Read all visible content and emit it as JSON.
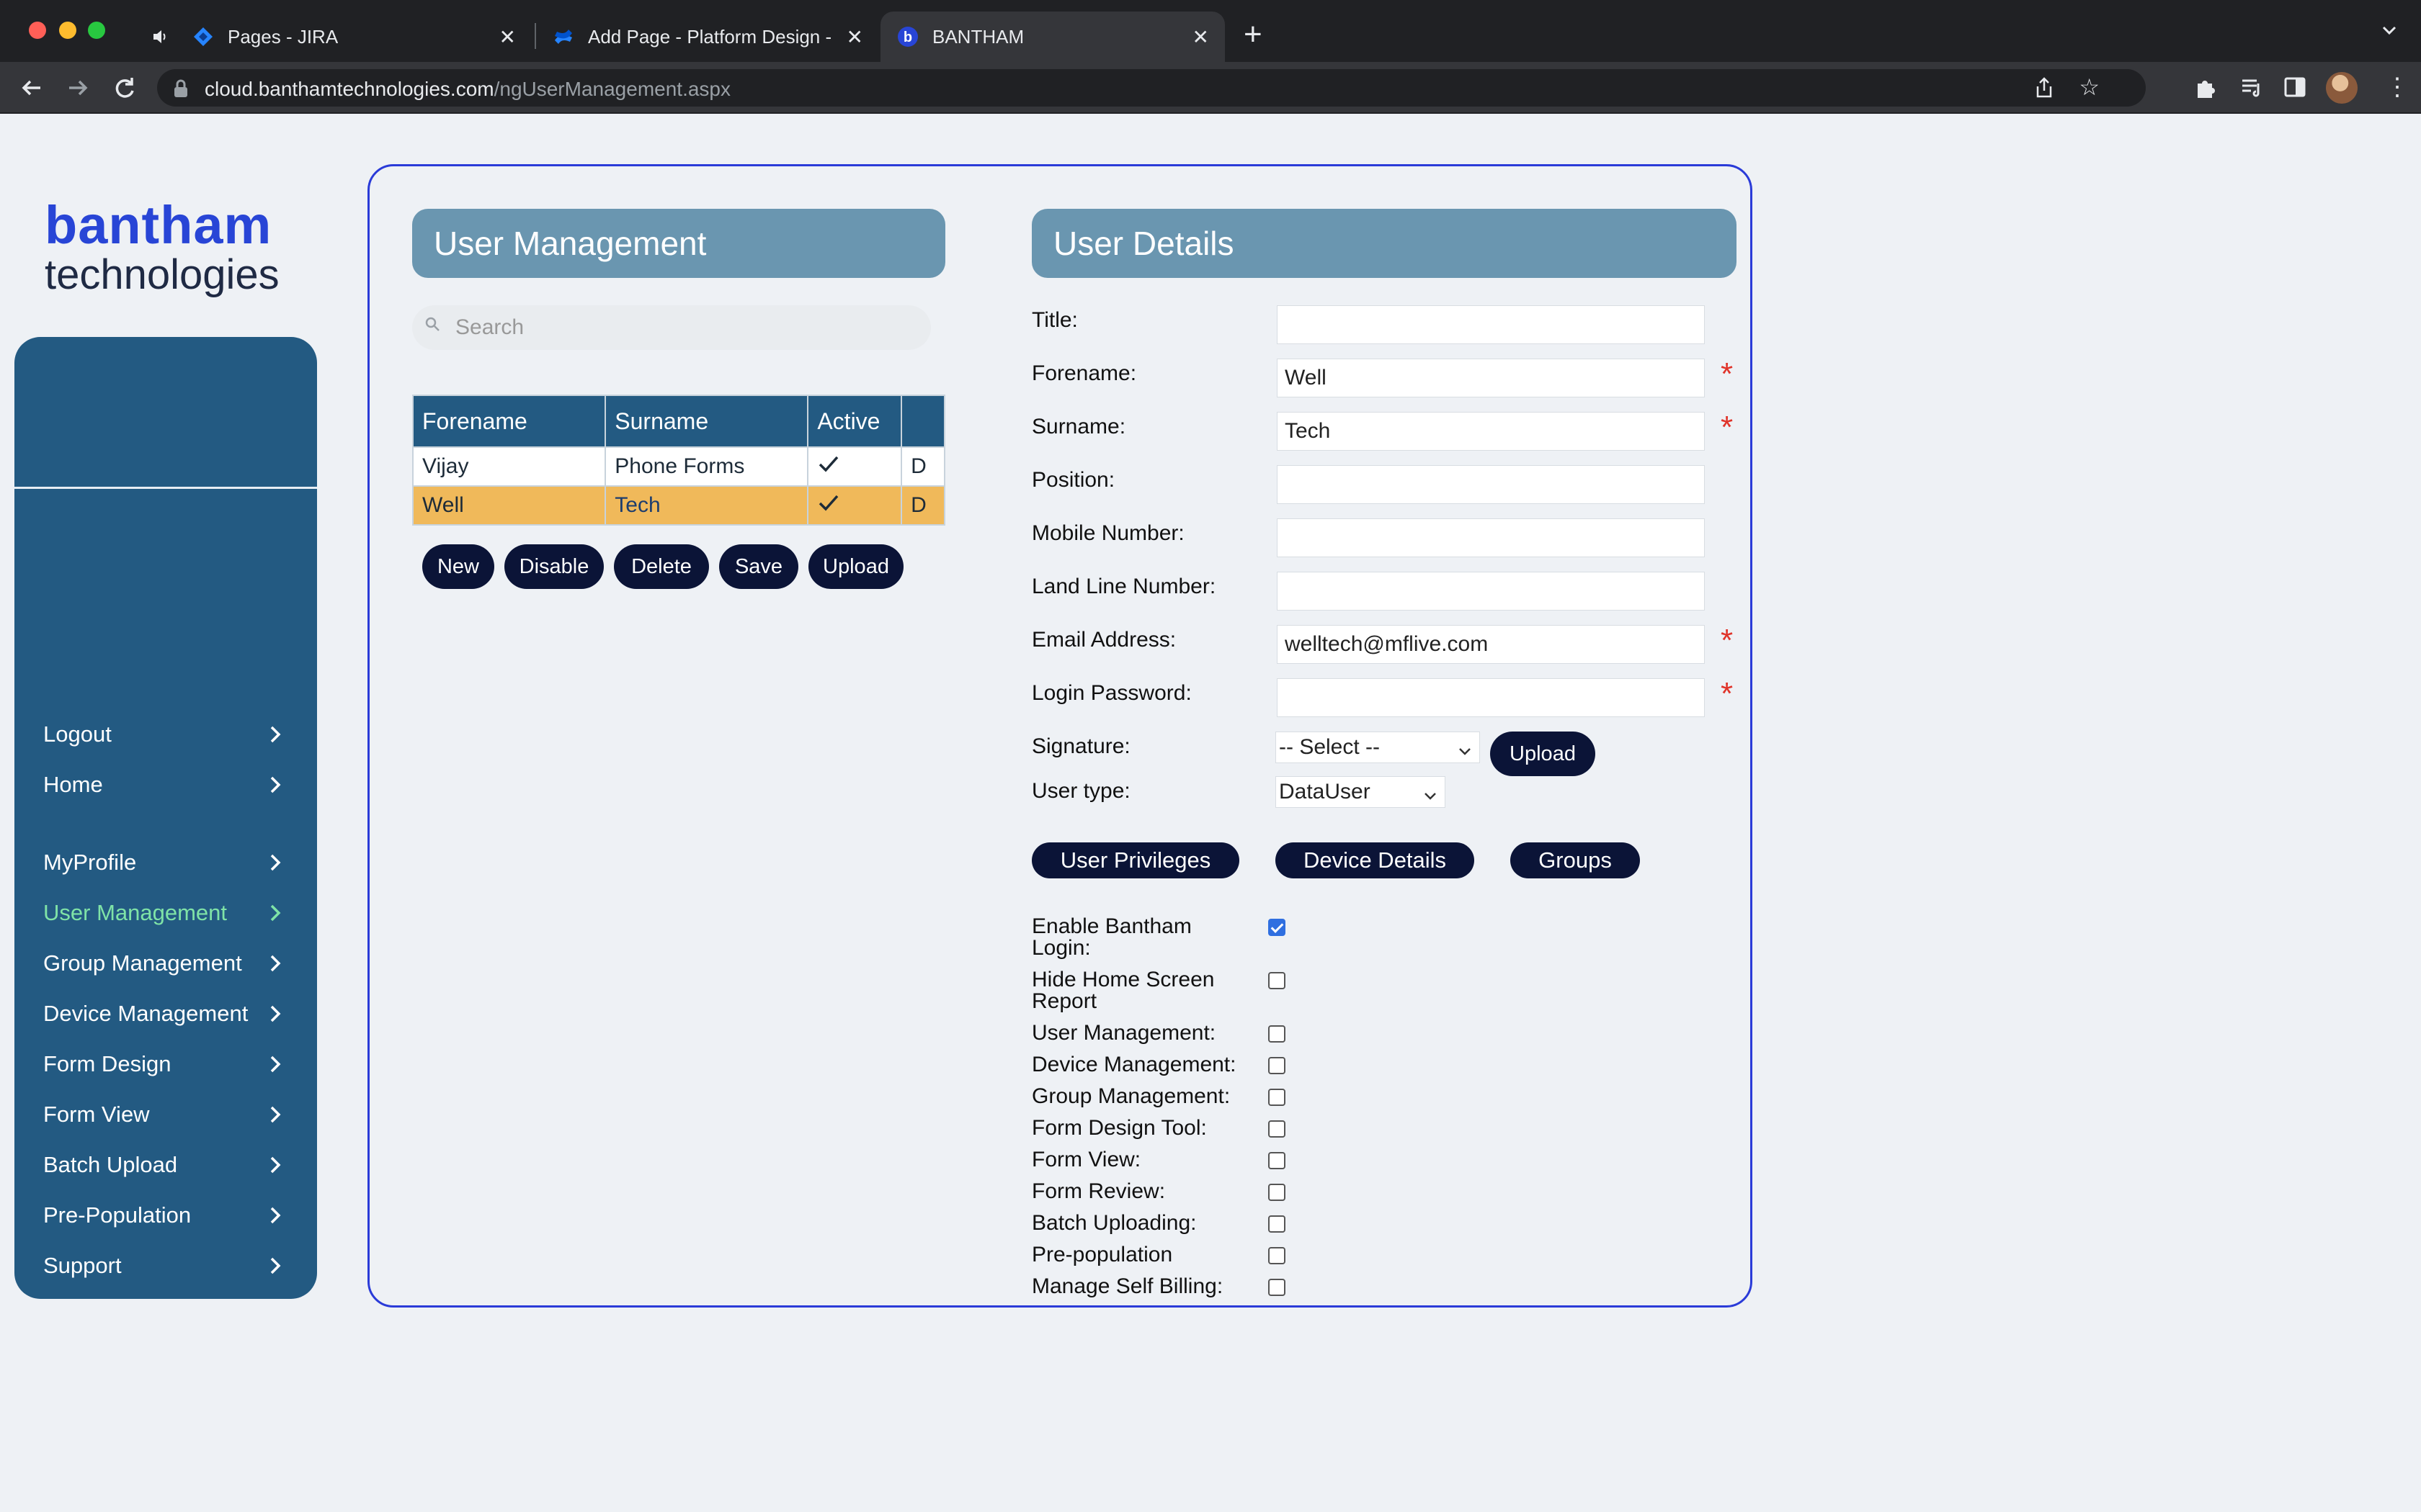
{
  "browser": {
    "tabs": [
      {
        "title": "Pages - JIRA",
        "icon": "jira-icon"
      },
      {
        "title": "Add Page - Platform Design - J",
        "icon": "confluence-icon"
      },
      {
        "title": "BANTHAM",
        "icon": "bantham-icon"
      }
    ],
    "url_domain": "cloud.banthamtechnologies.com",
    "url_path": "/ngUserManagement.aspx"
  },
  "logo": {
    "line1": "bantham",
    "line2": "technologies"
  },
  "sidebar": {
    "items": [
      {
        "label": "Logout",
        "active": false
      },
      {
        "label": "Home",
        "active": false
      },
      {
        "label": "MyProfile",
        "active": false
      },
      {
        "label": "User Management",
        "active": true
      },
      {
        "label": "Group Management",
        "active": false
      },
      {
        "label": "Device Management",
        "active": false
      },
      {
        "label": "Form Design",
        "active": false
      },
      {
        "label": "Form View",
        "active": false
      },
      {
        "label": "Batch Upload",
        "active": false
      },
      {
        "label": "Pre-Population",
        "active": false
      },
      {
        "label": "Support",
        "active": false
      }
    ]
  },
  "user_management": {
    "title": "User Management",
    "search_placeholder": "Search",
    "columns": [
      "Forename",
      "Surname",
      "Active",
      ""
    ],
    "rows": [
      {
        "forename": "Vijay",
        "surname": "Phone Forms",
        "active": "✓",
        "extra": "D",
        "selected": false
      },
      {
        "forename": "Well",
        "surname": "Tech",
        "active": "✓",
        "extra": "D",
        "selected": true
      }
    ],
    "buttons": [
      "New",
      "Disable",
      "Delete",
      "Save",
      "Upload"
    ]
  },
  "user_details": {
    "title": "User Details",
    "fields": {
      "title": {
        "label": "Title:",
        "value": ""
      },
      "forename": {
        "label": "Forename:",
        "value": "Well"
      },
      "surname": {
        "label": "Surname:",
        "value": "Tech"
      },
      "position": {
        "label": "Position:",
        "value": ""
      },
      "mobile": {
        "label": "Mobile Number:",
        "value": ""
      },
      "landline": {
        "label": "Land Line Number:",
        "value": ""
      },
      "email": {
        "label": "Email Address:",
        "value": "welltech@mflive.com"
      },
      "password": {
        "label": "Login Password:",
        "value": ""
      }
    },
    "required_mark": "*",
    "signature": {
      "label": "Signature:",
      "selected": "-- Select --",
      "upload_label": "Upload"
    },
    "user_type": {
      "label": "User type:",
      "selected": "DataUser"
    },
    "tabs": [
      "User Privileges",
      "Device Details",
      "Groups"
    ],
    "privileges": [
      {
        "label_line1": "Enable Bantham",
        "label_line2": "Login:",
        "checked": true
      },
      {
        "label_line1": "Hide Home Screen",
        "label_line2": "Report",
        "checked": false
      },
      {
        "label_line1": "User Management:",
        "label_line2": "",
        "checked": false
      },
      {
        "label_line1": "Device Management:",
        "label_line2": "",
        "checked": false
      },
      {
        "label_line1": "Group Management:",
        "label_line2": "",
        "checked": false
      },
      {
        "label_line1": "Form Design Tool:",
        "label_line2": "",
        "checked": false
      },
      {
        "label_line1": "Form View:",
        "label_line2": "",
        "checked": false
      },
      {
        "label_line1": "Form Review:",
        "label_line2": "",
        "checked": false
      },
      {
        "label_line1": "Batch Uploading:",
        "label_line2": "",
        "checked": false
      },
      {
        "label_line1": "Pre-population",
        "label_line2": "",
        "checked": false
      },
      {
        "label_line1": "Manage Self Billing:",
        "label_line2": "",
        "checked": false
      }
    ]
  },
  "colors": {
    "sidebar": "#235a82",
    "header_bar": "#6a96b0",
    "active_nav": "#7fe3a7",
    "selected_row": "#f0b95a",
    "button": "#0b1437",
    "required": "#e0342a",
    "panel_border": "#2a3bd8"
  }
}
